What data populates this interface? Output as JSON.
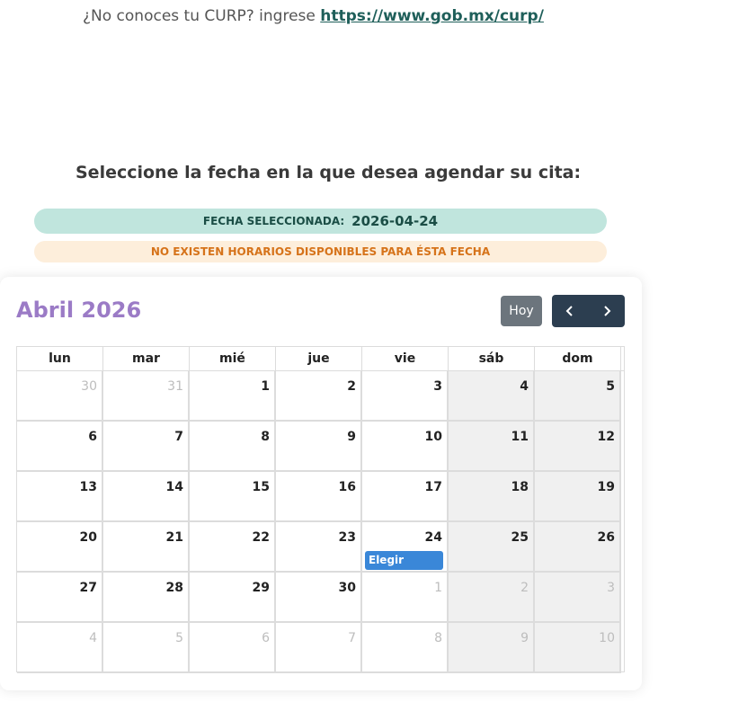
{
  "curp": {
    "prefix": "¿No conoces tu CURP? ingrese ",
    "link_text": "https://www.gob.mx/curp/"
  },
  "section_title": "Seleccione la fecha en la que desea agendar su cita:",
  "selected": {
    "label": "FECHA SELECCIONADA:",
    "value": "2026-04-24"
  },
  "warning": "NO EXISTEN HORARIOS DISPONIBLES PARA ÉSTA FECHA",
  "calendar": {
    "title": "Abril 2026",
    "today_label": "Hoy",
    "prev_icon": "chevron-left-icon",
    "next_icon": "chevron-right-icon",
    "weekdays": [
      "lun",
      "mar",
      "mié",
      "jue",
      "vie",
      "sáb",
      "dom"
    ],
    "event_label": "Elegir",
    "event_day": "24",
    "weeks": [
      [
        "30",
        "31",
        "1",
        "2",
        "3",
        "4",
        "5"
      ],
      [
        "6",
        "7",
        "8",
        "9",
        "10",
        "11",
        "12"
      ],
      [
        "13",
        "14",
        "15",
        "16",
        "17",
        "18",
        "19"
      ],
      [
        "20",
        "21",
        "22",
        "23",
        "24",
        "25",
        "26"
      ],
      [
        "27",
        "28",
        "29",
        "30",
        "1",
        "2",
        "3"
      ],
      [
        "4",
        "5",
        "6",
        "7",
        "8",
        "9",
        "10"
      ]
    ],
    "other_month": [
      [
        true,
        true,
        false,
        false,
        false,
        false,
        false
      ],
      [
        false,
        false,
        false,
        false,
        false,
        false,
        false
      ],
      [
        false,
        false,
        false,
        false,
        false,
        false,
        false
      ],
      [
        false,
        false,
        false,
        false,
        false,
        false,
        false
      ],
      [
        false,
        false,
        false,
        false,
        true,
        true,
        true
      ],
      [
        true,
        true,
        true,
        true,
        true,
        true,
        true
      ]
    ]
  },
  "colors": {
    "title_purple": "#9b7bc6",
    "selected_bg": "#c0e5dd",
    "warning_bg": "#fdeedb",
    "warning_text": "#d6731a",
    "nav_dark": "#2c3e50",
    "event_blue": "#3a87d8"
  }
}
